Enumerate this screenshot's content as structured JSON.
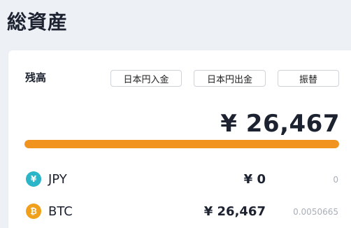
{
  "page": {
    "title": "総資産"
  },
  "balance": {
    "label": "残高",
    "buttons": {
      "deposit": "日本円入金",
      "withdraw": "日本円出金",
      "transfer": "振替"
    },
    "total": "¥ 26,467",
    "bar": {
      "fill_fraction": 1.0,
      "color": "#f0941f"
    }
  },
  "assets": [
    {
      "symbol": "¥",
      "icon": "yen-icon",
      "icon_color": "#2bb5c8",
      "name": "JPY",
      "jpy_value": "¥ 0",
      "amount": "0"
    },
    {
      "symbol": "₿",
      "icon": "bitcoin-icon",
      "icon_color": "#f0a01a",
      "name": "BTC",
      "jpy_value": "¥ 26,467",
      "amount": "0.0050665"
    }
  ]
}
